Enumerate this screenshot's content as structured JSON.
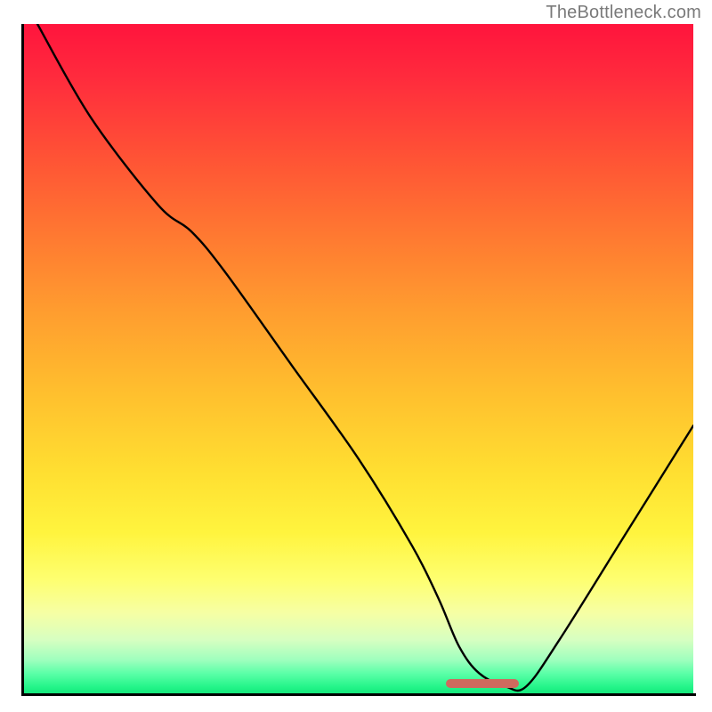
{
  "watermark_text": "TheBottleneck.com",
  "chart_data": {
    "type": "line",
    "title": "",
    "xlabel": "",
    "ylabel": "",
    "xlim": [
      0,
      100
    ],
    "ylim": [
      0,
      100
    ],
    "background_gradient": "rainbow (red→yellow→green top-to-bottom)",
    "series": [
      {
        "name": "bottleneck-curve",
        "x": [
          2,
          10,
          20,
          25,
          30,
          40,
          50,
          58,
          62,
          65,
          68,
          72,
          75,
          80,
          90,
          100
        ],
        "values": [
          100,
          86,
          73,
          69,
          63,
          49,
          35,
          22,
          14,
          7,
          3,
          1,
          1,
          8,
          24,
          40
        ]
      }
    ],
    "marker": {
      "name": "optimal-range",
      "x_start": 63,
      "x_end": 74,
      "y": 1.5
    }
  }
}
